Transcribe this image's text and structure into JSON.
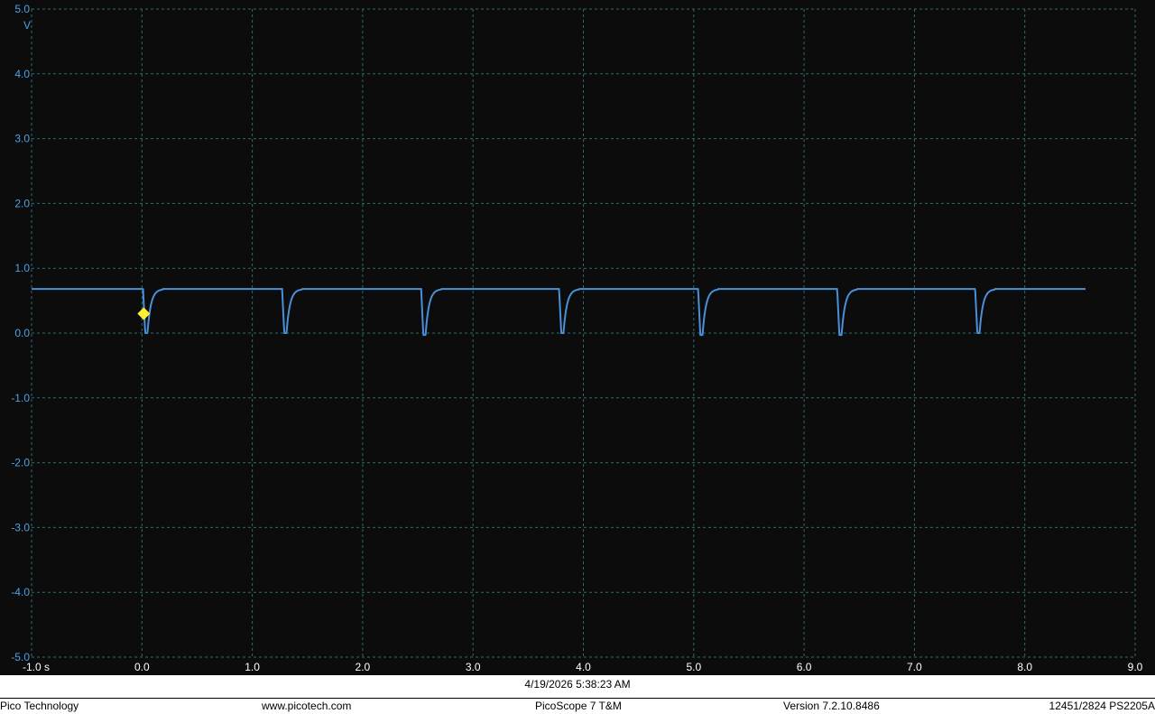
{
  "chart_data": {
    "type": "line",
    "y_unit": "V",
    "x_unit": "s",
    "xlim": [
      -1.0,
      9.0
    ],
    "ylim": [
      -5.0,
      5.0
    ],
    "x_ticks": [
      "-1.0 s",
      "0.0",
      "1.0",
      "2.0",
      "3.0",
      "4.0",
      "5.0",
      "6.0",
      "7.0",
      "8.0",
      "9.0"
    ],
    "y_ticks": [
      "5.0",
      "4.0",
      "3.0",
      "2.0",
      "1.0",
      "0.0",
      "-1.0",
      "-2.0",
      "-3.0",
      "-4.0",
      "-5.0"
    ],
    "grid": true,
    "series": [
      {
        "color": "#4a90d9",
        "baseline": 0.68,
        "x_range": [
          -1.0,
          8.55
        ],
        "dips": [
          {
            "x": 0.03,
            "min": 0.0
          },
          {
            "x": 1.29,
            "min": 0.0
          },
          {
            "x": 2.55,
            "min": -0.03
          },
          {
            "x": 3.8,
            "min": 0.0
          },
          {
            "x": 5.06,
            "min": -0.03
          },
          {
            "x": 6.32,
            "min": -0.03
          },
          {
            "x": 7.57,
            "min": 0.0
          }
        ]
      }
    ],
    "trigger": {
      "x": 0.0,
      "y": 0.3,
      "color": "#ffee33"
    }
  },
  "timestamp": "4/19/2026 5:38:23 AM",
  "footer": {
    "company": "Pico Technology",
    "website": "www.picotech.com",
    "product": "PicoScope 7 T&M",
    "version": "Version 7.2.10.8486",
    "device": "12451/2824 PS2205A"
  }
}
